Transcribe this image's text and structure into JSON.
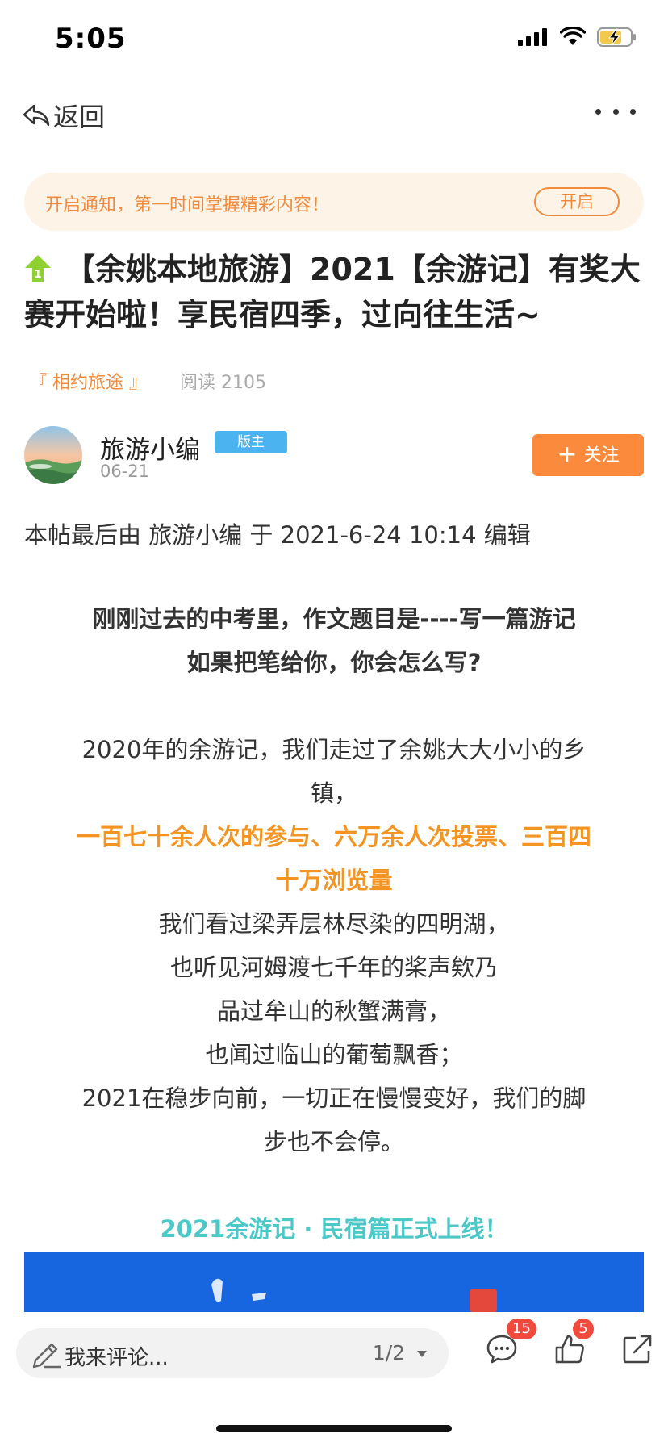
{
  "status_bar": {
    "time": "5:05"
  },
  "nav": {
    "back_label": "返回"
  },
  "notification": {
    "text": "开启通知，第一时间掌握精彩内容！",
    "button_label": "开启"
  },
  "post": {
    "top_badge": "1",
    "title": "【余姚本地旅游】2021【余游记】有奖大赛开始啦！享民宿四季，过向往生活~",
    "forum": "『 相约旅途 』",
    "read_label": "阅读 2105"
  },
  "author": {
    "name": "旅游小编",
    "role_badge": "版主",
    "date": "06-21",
    "follow_label": "关注"
  },
  "edit_note": "本帖最后由 旅游小编 于 2021-6-24 10:14 编辑",
  "content": {
    "lines": [
      "刚刚过去的中考里，作文题目是----写一篇游记",
      "如果把笔给你，你会怎么写?",
      "2020年的余游记，我们走过了余姚大大小小的乡",
      "镇，",
      "一百七十余人次的参与、六万余人次投票、三百四",
      "十万浏览量",
      "我们看过梁弄层林尽染的四明湖，",
      "也听见河姆渡七千年的桨声欸乃",
      "品过牟山的秋蟹满膏，",
      "也闻过临山的葡萄飘香；",
      "2021在稳步向前，一切正在慢慢变好，我们的脚",
      "步也不会停。",
      "2021余游记 · 民宿篇正式上线！"
    ]
  },
  "bottom_bar": {
    "comment_placeholder": "我来评论...",
    "page_indicator": "1/2",
    "comment_count": "15",
    "like_count": "5"
  },
  "colors": {
    "accent_orange": "#f08a3c",
    "follow_button": "#fb8a3c",
    "highlight_orange": "#f49422",
    "highlight_cyan": "#4bc8c8",
    "badge_red": "#f04a3e",
    "mod_badge_blue": "#4ab3f0",
    "image_blue": "#1766e0"
  },
  "icons": [
    "cellular-signal-icon",
    "wifi-icon",
    "battery-charging-icon",
    "back-arrow-icon",
    "more-dots-icon",
    "top-rank-icon",
    "pen-icon",
    "dropdown-caret-icon",
    "comment-icon",
    "thumbs-up-icon",
    "share-icon"
  ]
}
